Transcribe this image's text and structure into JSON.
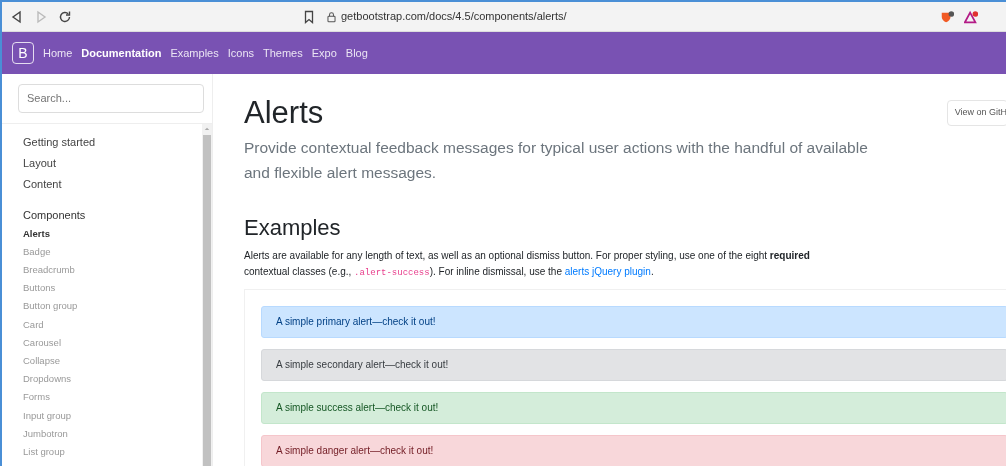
{
  "browser": {
    "address": "getbootstrap.com/docs/4.5/components/alerts/",
    "forward_disabled": true
  },
  "navbar": {
    "brand": "B",
    "links": [
      {
        "label": "Home",
        "selected": false
      },
      {
        "label": "Documentation",
        "selected": true
      },
      {
        "label": "Examples",
        "selected": false
      },
      {
        "label": "Icons",
        "selected": false
      },
      {
        "label": "Themes",
        "selected": false
      },
      {
        "label": "Expo",
        "selected": false
      },
      {
        "label": "Blog",
        "selected": false
      }
    ]
  },
  "sidebar": {
    "search": {
      "placeholder": "Search..."
    },
    "groups": [
      {
        "items": [
          {
            "label": "Getting started"
          },
          {
            "label": "Layout"
          },
          {
            "label": "Content"
          }
        ]
      },
      {
        "title": "Components",
        "items": [
          {
            "label": "Alerts",
            "selected": true
          },
          {
            "label": "Badge",
            "selected": false
          },
          {
            "label": "Breadcrumb",
            "selected": false
          },
          {
            "label": "Buttons",
            "selected": false
          },
          {
            "label": "Button group",
            "selected": false
          },
          {
            "label": "Card",
            "selected": false
          },
          {
            "label": "Carousel",
            "selected": false
          },
          {
            "label": "Collapse",
            "selected": false
          },
          {
            "label": "Dropdowns",
            "selected": false
          },
          {
            "label": "Forms",
            "selected": false
          },
          {
            "label": "Input group",
            "selected": false
          },
          {
            "label": "Jumbotron",
            "selected": false
          },
          {
            "label": "List group",
            "selected": false
          }
        ]
      }
    ]
  },
  "main": {
    "title": "Alerts",
    "lead": "Provide contextual feedback messages for typical user actions with the handful of available and flexible alert messages.",
    "github_button": "View on GitH",
    "section_title": "Examples",
    "intro": [
      {
        "kind": "text",
        "text": "Alerts are available for any length of text, as well as an optional dismiss button. For proper styling, use one of the eight **required** contextual classes (e.g., "
      },
      {
        "kind": "code",
        "text": ".alert-success"
      },
      {
        "kind": "text",
        "text": "). For inline dismissal, use the "
      },
      {
        "kind": "link",
        "text": "alerts jQuery plugin"
      },
      {
        "kind": "text",
        "text": "."
      }
    ],
    "alerts": [
      {
        "kind": "primary",
        "text": "A simple primary alert—check it out!"
      },
      {
        "kind": "secondary",
        "text": "A simple secondary alert—check it out!"
      },
      {
        "kind": "success",
        "text": "A simple success alert—check it out!"
      },
      {
        "kind": "danger",
        "text": "A simple danger alert—check it out!"
      }
    ]
  }
}
